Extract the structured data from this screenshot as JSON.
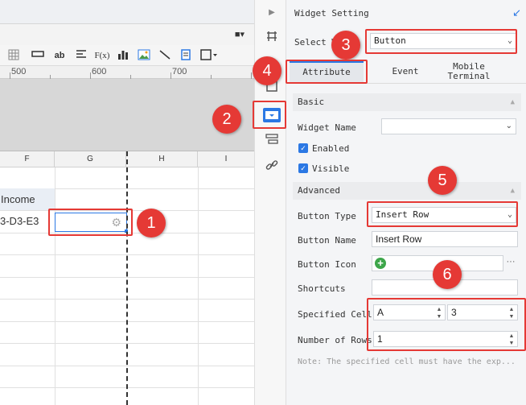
{
  "toolbar": {
    "icons": [
      "grid-icon",
      "ellipsis-icon",
      "ab-text-icon",
      "align-left-icon",
      "formula-icon",
      "bar-chart-icon",
      "image-icon",
      "slash-icon",
      "document-icon",
      "border-dropdown-icon"
    ],
    "ab_label": "ab",
    "fx_label": "F(x)"
  },
  "ruler": {
    "marks": [
      "500",
      "600",
      "700"
    ]
  },
  "columns": [
    "F",
    "G",
    "H",
    "I"
  ],
  "cells": {
    "income": "Income",
    "formula": "3-D3-E3"
  },
  "badges": [
    "1",
    "2",
    "3",
    "4",
    "5",
    "6"
  ],
  "panel": {
    "title": "Widget Setting",
    "select_label": "Select W",
    "select_value": "Button",
    "tabs": [
      "Attribute",
      "Event",
      "Mobile Terminal"
    ],
    "basic": "Basic",
    "widget_name_label": "Widget Name",
    "widget_name_value": "",
    "enabled_label": "Enabled",
    "visible_label": "Visible",
    "advanced": "Advanced",
    "button_type_label": "Button Type",
    "button_type_value": "Insert Row",
    "button_name_label": "Button Name",
    "button_name_value": "Insert Row",
    "button_icon_label": "Button Icon",
    "button_icon_more": "···",
    "shortcuts_label": "Shortcuts",
    "shortcuts_value": "",
    "specified_cell_label": "Specified Cell",
    "specified_col": "A",
    "specified_row": "3",
    "rows_label": "Number of Rows",
    "rows_value": "1",
    "note": "Note: The specified cell must have the exp..."
  },
  "colors": {
    "accent": "#2b78e4",
    "badge": "#e53935"
  }
}
